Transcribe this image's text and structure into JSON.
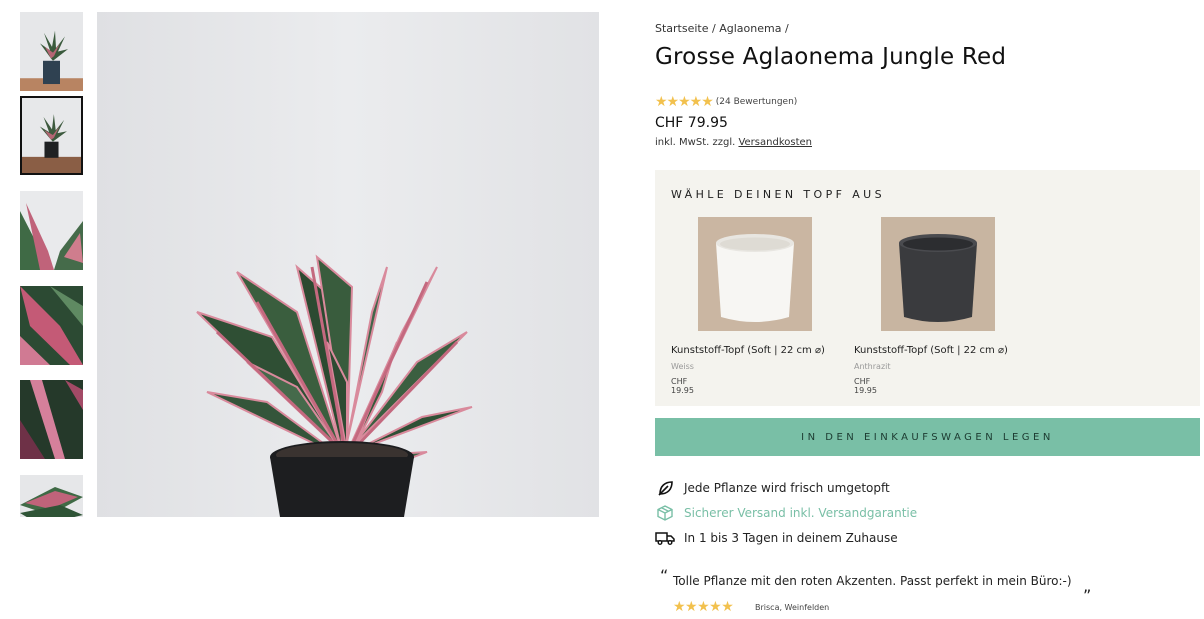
{
  "breadcrumb": {
    "home": "Startseite",
    "separator": " / ",
    "category": "Aglaonema",
    "trailing": " /"
  },
  "product": {
    "title": "Grosse Aglaonema Jungle Red",
    "rating_stars": "★★★★★",
    "rating_value": 4.5,
    "review_count": "(24 Bewertungen)",
    "price": "CHF 79.95",
    "tax_prefix": "inkl. MwSt. zzgl. ",
    "shipping_link": "Versandkosten"
  },
  "gallery": {
    "thumbnail_count": 6,
    "active_index": 1
  },
  "pot_selector": {
    "heading": "WÄHLE DEINEN TOPF AUS",
    "options": [
      {
        "name": "Kunststoff-Topf (Soft | 22 cm ⌀)",
        "color": "Weiss",
        "price": "CHF 19.95",
        "swatch": "#ffffff"
      },
      {
        "name": "Kunststoff-Topf (Soft | 22 cm ⌀)",
        "color": "Anthrazit",
        "price": "CHF 19.95",
        "swatch": "#3a3b3e"
      }
    ]
  },
  "cart_button": "IN DEN EINKAUFSWAGEN LEGEN",
  "features": [
    {
      "icon": "leaf-icon",
      "text": "Jede Pflanze wird frisch umgetopft"
    },
    {
      "icon": "box-icon",
      "text": "Sicherer Versand inkl. Versandgarantie"
    },
    {
      "icon": "truck-icon",
      "text": "In 1 bis 3 Tagen in deinem Zuhause"
    }
  ],
  "testimonial": {
    "open_quote": "“",
    "text": "Tolle Pflanze mit den roten Akzenten. Passt perfekt in mein Büro:-)",
    "close_quote": "”",
    "stars": "★★★★★",
    "author": "Brisca, Weinfelden"
  },
  "colors": {
    "accent": "#79bfa6",
    "star": "#f2c14e",
    "panel": "#f4f3ee"
  }
}
